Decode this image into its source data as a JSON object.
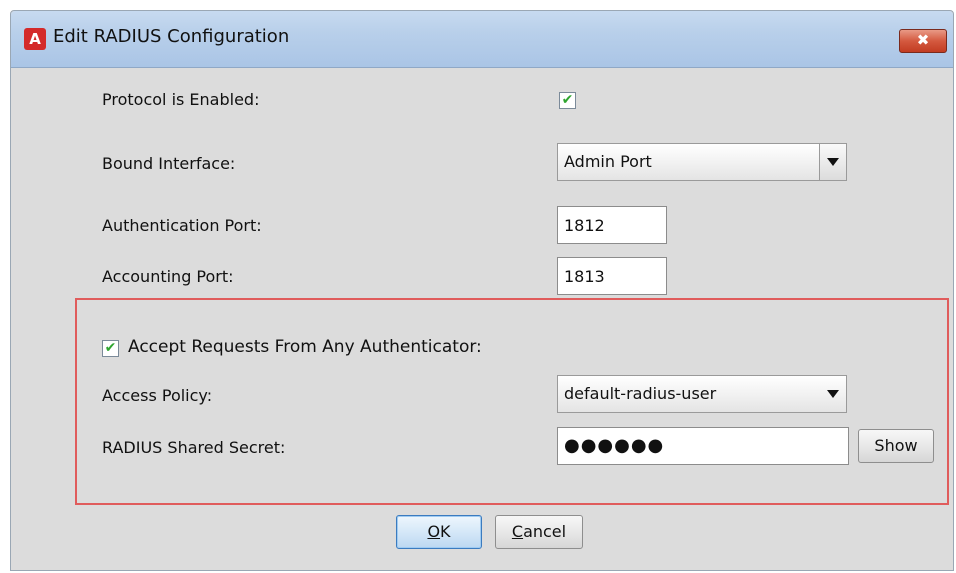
{
  "window": {
    "title": "Edit RADIUS Configuration",
    "app_icon_letter": "A",
    "close_glyph": "✖"
  },
  "form": {
    "protocol_enabled_label": "Protocol is Enabled:",
    "protocol_enabled_checked": true,
    "bound_interface_label": "Bound Interface:",
    "bound_interface_value": "Admin Port",
    "auth_port_label": "Authentication Port:",
    "auth_port_value": "1812",
    "acct_port_label": "Accounting Port:",
    "acct_port_value": "1813",
    "accept_any_label": "Accept Requests From Any Authenticator:",
    "accept_any_checked": true,
    "access_policy_label": "Access Policy:",
    "access_policy_value": "default-radius-user",
    "shared_secret_label": "RADIUS Shared Secret:",
    "shared_secret_value": "●●●●●●",
    "show_button": "Show"
  },
  "check_glyph": "✔",
  "buttons": {
    "ok_mnemonic": "O",
    "ok_rest": "K",
    "cancel_mnemonic": "C",
    "cancel_rest": "ancel"
  },
  "colors": {
    "highlight_border": "#e05c5c",
    "check_green": "#2fa52f",
    "close_red": "#c23c22"
  }
}
